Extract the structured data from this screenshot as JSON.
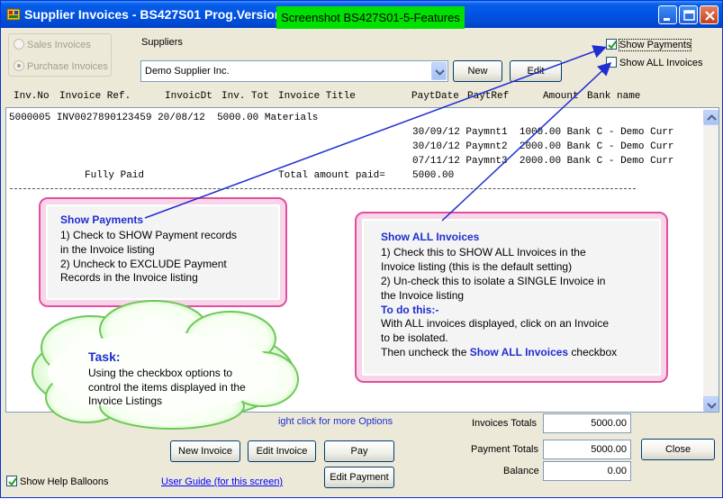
{
  "window": {
    "title": "Supplier Invoices - BS427S01   Prog.Version:",
    "banner": "Screenshot BS427S01-5-Features"
  },
  "invoice_type": {
    "options": [
      "Sales Invoices",
      "Purchase Invoices"
    ],
    "selected": "Purchase Invoices"
  },
  "suppliers": {
    "label": "Suppliers",
    "selected": "Demo Supplier Inc.",
    "new_label": "New",
    "edit_label": "Edit"
  },
  "options": {
    "show_payments_label": "Show Payments",
    "show_payments_checked": true,
    "show_all_invoices_label": "Show ALL Invoices",
    "show_all_invoices_checked": false
  },
  "listing": {
    "columns": [
      "Inv.No",
      "Invoice Ref.",
      "InvoicDt",
      "Inv. Tot",
      "Invoice Title",
      "PaytDate",
      "PaytRef",
      "Amount",
      "Bank name"
    ],
    "invoice_row": {
      "inv_no": "5000005",
      "ref": "INV0027890123459",
      "date": "20/08/12",
      "total": "5000.00",
      "title": "Materials"
    },
    "payments": [
      {
        "date": "30/09/12",
        "ref": "Paymnt1",
        "amount": "1000.00",
        "bank": "Bank C - Demo Curr"
      },
      {
        "date": "30/10/12",
        "ref": "Paymnt2",
        "amount": "2000.00",
        "bank": "Bank C - Demo Curr"
      },
      {
        "date": "07/11/12",
        "ref": "Paymnt3",
        "amount": "2000.00",
        "bank": "Bank C - Demo Curr"
      }
    ],
    "status": "Fully Paid",
    "total_paid_label": "Total amount paid=",
    "total_paid_value": "5000.00"
  },
  "balloon_payments": {
    "title": "Show Payments",
    "lines": [
      "1) Check to SHOW Payment records",
      "in the Invoice listing",
      "2) Uncheck to EXCLUDE  Payment",
      "Records in the Invoice listing"
    ]
  },
  "balloon_all": {
    "title": "Show ALL Invoices",
    "lines": [
      "1) Check this to SHOW ALL Invoices in the",
      "Invoice listing (this is the default setting)",
      "2) Un-check this to isolate a SINGLE Invoice in",
      "the Invoice listing"
    ],
    "subtitle": "To do this:-",
    "lines2": [
      "With ALL invoices displayed, click on an Invoice",
      "to be isolated."
    ],
    "last_pre": "Then uncheck the ",
    "last_bold": "Show ALL Invoices",
    "last_post": " checkbox"
  },
  "task": {
    "title": "Task:",
    "lines": [
      "Using the checkbox options to",
      "control the items displayed in the",
      "Invoice Listings"
    ]
  },
  "footer": {
    "right_click_hint": "Right click for more Options",
    "invoices_totals_label": "Invoices Totals",
    "invoices_totals": "5000.00",
    "payment_totals_label": "Payment Totals",
    "payment_totals": "5000.00",
    "balance_label": "Balance",
    "balance": "0.00",
    "new_invoice": "New Invoice",
    "edit_invoice": "Edit Invoice",
    "pay": "Pay",
    "edit_payment": "Edit Payment",
    "close": "Close",
    "show_help_balloons": "Show Help Balloons",
    "user_guide": "User Guide (for this screen)"
  }
}
